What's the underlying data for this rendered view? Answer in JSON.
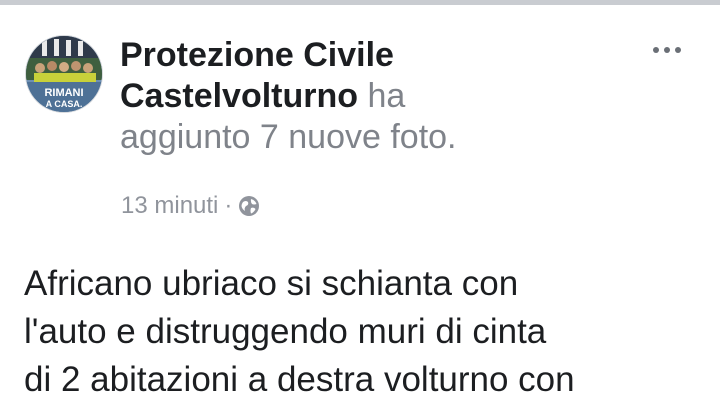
{
  "post": {
    "page_name_line1": "Protezione Civile",
    "page_name_line2": "Castelvolturno",
    "action_part1": "ha",
    "action_part2": "aggiunto 7 nuove foto.",
    "timestamp": "13 minuti",
    "separator": "·",
    "privacy_icon": "globe-icon",
    "more_icon": "more-options-icon",
    "avatar": {
      "badge_line1": "RIMANI",
      "badge_line2": "A CASA."
    },
    "text_line1": "Africano ubriaco si schianta con",
    "text_line2": "l'auto e distruggendo muri di cinta",
    "text_line3": "di 2 abitazioni a destra volturno con"
  },
  "colors": {
    "text_primary": "#1c1e21",
    "text_secondary": "#90949c",
    "divider": "#c9ccd1"
  }
}
